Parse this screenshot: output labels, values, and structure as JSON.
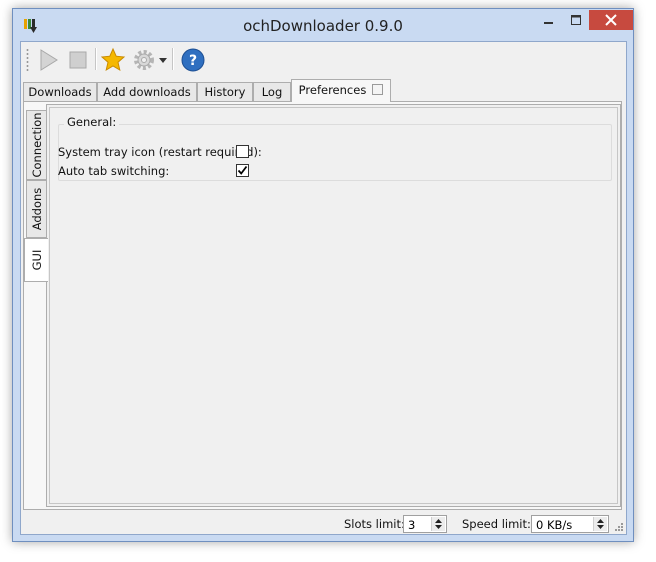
{
  "window": {
    "title": "ochDownloader 0.9.0"
  },
  "toolbar": {
    "start_icon": "play-icon",
    "stop_icon": "stop-icon",
    "favorite_icon": "star-icon",
    "settings_icon": "gear-icon",
    "help_icon": "help-icon"
  },
  "tabs": [
    {
      "label": "Downloads"
    },
    {
      "label": "Add downloads"
    },
    {
      "label": "History"
    },
    {
      "label": "Log"
    },
    {
      "label": "Preferences"
    }
  ],
  "side_tabs": [
    {
      "label": "Connection"
    },
    {
      "label": "Addons"
    },
    {
      "label": "GUI"
    }
  ],
  "general": {
    "title": "General:",
    "options": [
      {
        "label": "System tray icon (restart required):",
        "checked": false
      },
      {
        "label": "Auto tab switching:",
        "checked": true
      }
    ]
  },
  "status": {
    "slots_label": "Slots limit:",
    "slots_value": "3",
    "speed_label": "Speed limit:",
    "speed_value": "0 KB/s"
  },
  "colors": {
    "frame": "#c9daf2",
    "close_button": "#c74a3f",
    "star": "#f5b800",
    "help": "#2f6fc0"
  }
}
